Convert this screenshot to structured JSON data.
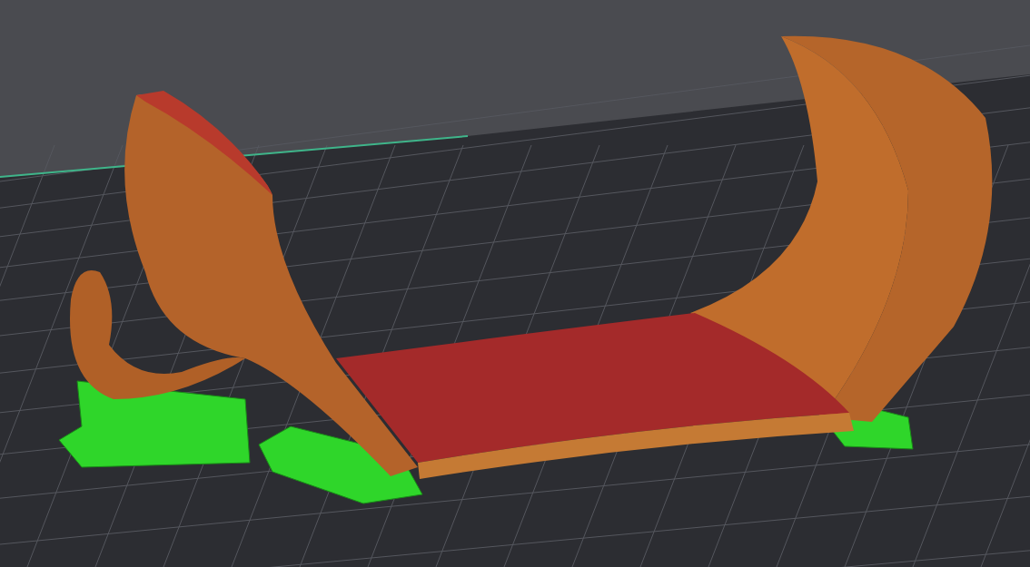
{
  "viewport": {
    "show_grid": true,
    "show_supports": true
  }
}
